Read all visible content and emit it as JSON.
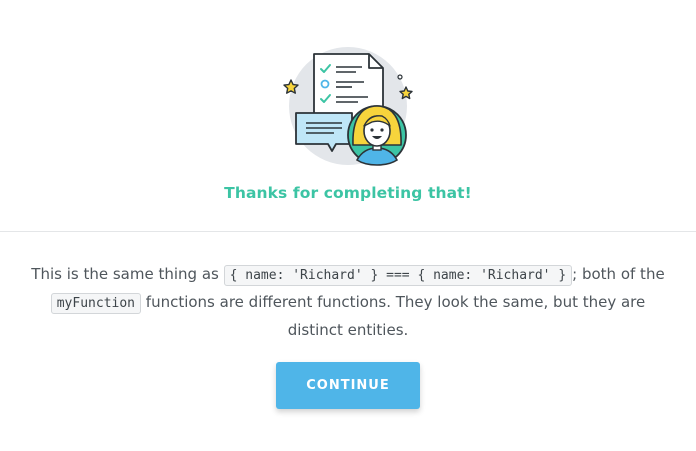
{
  "feedback": {
    "title": "Thanks for completing that!"
  },
  "explanation": {
    "part1": "This is the same thing as ",
    "code1": "{ name: 'Richard' } === { name: 'Richard' }",
    "part2": "; both of the ",
    "code2": "myFunction",
    "part3": " functions are different functions. They look the same, but they are distinct entities."
  },
  "continue_button": {
    "label": "CONTINUE"
  },
  "colors": {
    "accent_green": "#3cc4a4",
    "button_blue": "#4fb5e8",
    "star_yellow": "#f7d43c"
  },
  "illustration_icons": [
    "document-checklist-icon",
    "speech-bubble-icon",
    "smiling-avatar-icon",
    "star-icon"
  ]
}
